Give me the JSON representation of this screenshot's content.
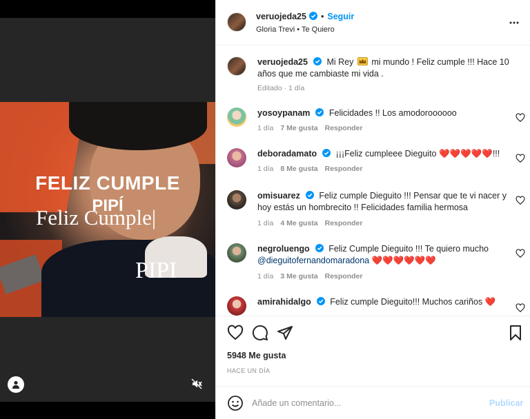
{
  "post": {
    "username": "veruojeda25",
    "follow_label": "Seguir",
    "separator": "•",
    "song": "Gloria Trevi • Te Quiero",
    "more_icon": "more-options-icon"
  },
  "media": {
    "overlay_line1": "FELIZ CUMPLE",
    "overlay_line2": "PIPÍ",
    "overlay_line3": "Feliz Cumple|",
    "overlay_line4": "PIPI",
    "user_tag_icon": "user-tag-icon",
    "mute_icon": "mute-icon"
  },
  "caption": {
    "username": "veruojeda25",
    "text_before": "Mi Rey",
    "text_after": "mi mundo ! Feliz cumple !!! Hace 10 años que me cambiaste mi vida .",
    "meta": "Editado · 1 día"
  },
  "comments": [
    {
      "username": "yosoypanam",
      "text": "Felicidades !! Los amodoroooooo",
      "time": "1 día",
      "likes": "7 Me gusta",
      "reply": "Responder"
    },
    {
      "username": "deboradamato",
      "text": "¡¡¡Feliz cumpleee Dieguito",
      "hearts": "❤️❤️❤️❤️❤️",
      "text_after": "!!!",
      "time": "1 día",
      "likes": "8 Me gusta",
      "reply": "Responder"
    },
    {
      "username": "omisuarez",
      "text": "Feliz cumple Dieguito !!! Pensar que te vi nacer y hoy estás un hombrecito !! Felicidades familia hermosa",
      "time": "1 día",
      "likes": "4 Me gusta",
      "reply": "Responder"
    },
    {
      "username": "negroluengo",
      "text": "Feliz Cumple Dieguito !!! Te quiero mucho",
      "mention": "@dieguitofernandomaradona",
      "hearts": "❤️❤️❤️❤️❤️❤️",
      "time": "1 día",
      "likes": "3 Me gusta",
      "reply": "Responder"
    },
    {
      "username": "amirahidalgo",
      "text": "Feliz cumple Dieguito!!! Muchos cariños",
      "hearts": "❤️"
    }
  ],
  "footer": {
    "likes": "5948 Me gusta",
    "when": "HACE UN DÍA",
    "comment_placeholder": "Añade un comentario...",
    "publish_label": "Publicar"
  },
  "colors": {
    "accent": "#0095f6",
    "heart": "#ed4956",
    "muted": "#8e8e8e",
    "publish_disabled": "#b3dbff"
  }
}
